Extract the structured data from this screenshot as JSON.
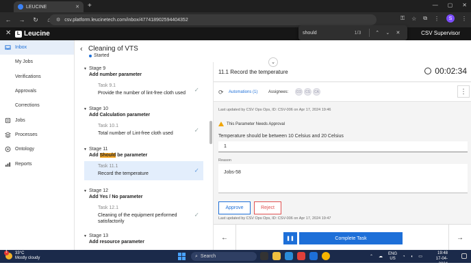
{
  "browser": {
    "tab_title": "LEUCINE",
    "url": "csv.platform.leucinetech.com/inbox/477418902594404352"
  },
  "find": {
    "query": "should",
    "count": "1/3"
  },
  "app": {
    "logo": "Leucine",
    "role": "CSV Supervisor"
  },
  "sidebar": {
    "items": [
      {
        "label": "Inbox",
        "icon": "inbox-icon"
      },
      {
        "label": "My Jobs",
        "icon": ""
      },
      {
        "label": "Verifications",
        "icon": ""
      },
      {
        "label": "Approvals",
        "icon": ""
      },
      {
        "label": "Corrections",
        "icon": ""
      },
      {
        "label": "Jobs",
        "icon": "jobs-icon"
      },
      {
        "label": "Processes",
        "icon": "processes-icon"
      },
      {
        "label": "Ontology",
        "icon": "ontology-icon"
      },
      {
        "label": "Reports",
        "icon": "reports-icon"
      }
    ]
  },
  "job": {
    "title": "Cleaning of VTS",
    "status": "Started"
  },
  "stages": [
    {
      "label": "Stage 9",
      "name": "Add number parameter",
      "tasks": [
        {
          "id": "Task 9.1",
          "name": "Provide the number of lint-free cloth used"
        }
      ]
    },
    {
      "label": "Stage 10",
      "name": "Add Calculation parameter",
      "tasks": [
        {
          "id": "Task 10.1",
          "name": "Total number of Lint-free cloth used"
        }
      ]
    },
    {
      "label": "Stage 11",
      "name_pre": "Add ",
      "name_hl": "Should",
      "name_post": " be parameter",
      "tasks": [
        {
          "id": "Task 11.1",
          "name": "Record the temperature"
        }
      ]
    },
    {
      "label": "Stage 12",
      "name": "Add Yes / No parameter",
      "tasks": [
        {
          "id": "Task 12.1",
          "name": "Cleaning of the equipment performed satisfactorily"
        }
      ]
    },
    {
      "label": "Stage 13",
      "name": "Add resource parameter"
    }
  ],
  "task": {
    "title": "11.1 Record the temperature",
    "timer": "00:02:34",
    "automations": "Automations (1)",
    "assignees_label": "Assignees:",
    "assignees": [
      "CO",
      "CS",
      "CA"
    ],
    "updated_top": "Last updated by CSV Ops Ops, ID: CSV-006 on Apr 17, 2024 19:46",
    "approval_warning": "This Parameter Needs Approval",
    "param_label": "Temperature should be between 10 Celsius and 20 Celsius",
    "param_value": "1",
    "reason_label": "Reason",
    "reason_value": "Jobs-58",
    "approve": "Approve",
    "reject": "Reject",
    "updated_bottom": "Last updated by CSV Ops Ops, ID: CSV-006 on Apr 17, 2024 19:47",
    "complete": "Complete Task"
  },
  "taskbar": {
    "temp": "33°C",
    "weather": "Mostly cloudy",
    "search_placeholder": "Search",
    "lang1": "ENG",
    "lang2": "US",
    "time": "19:48",
    "date": "17-04-2024",
    "notif_count": "1"
  }
}
